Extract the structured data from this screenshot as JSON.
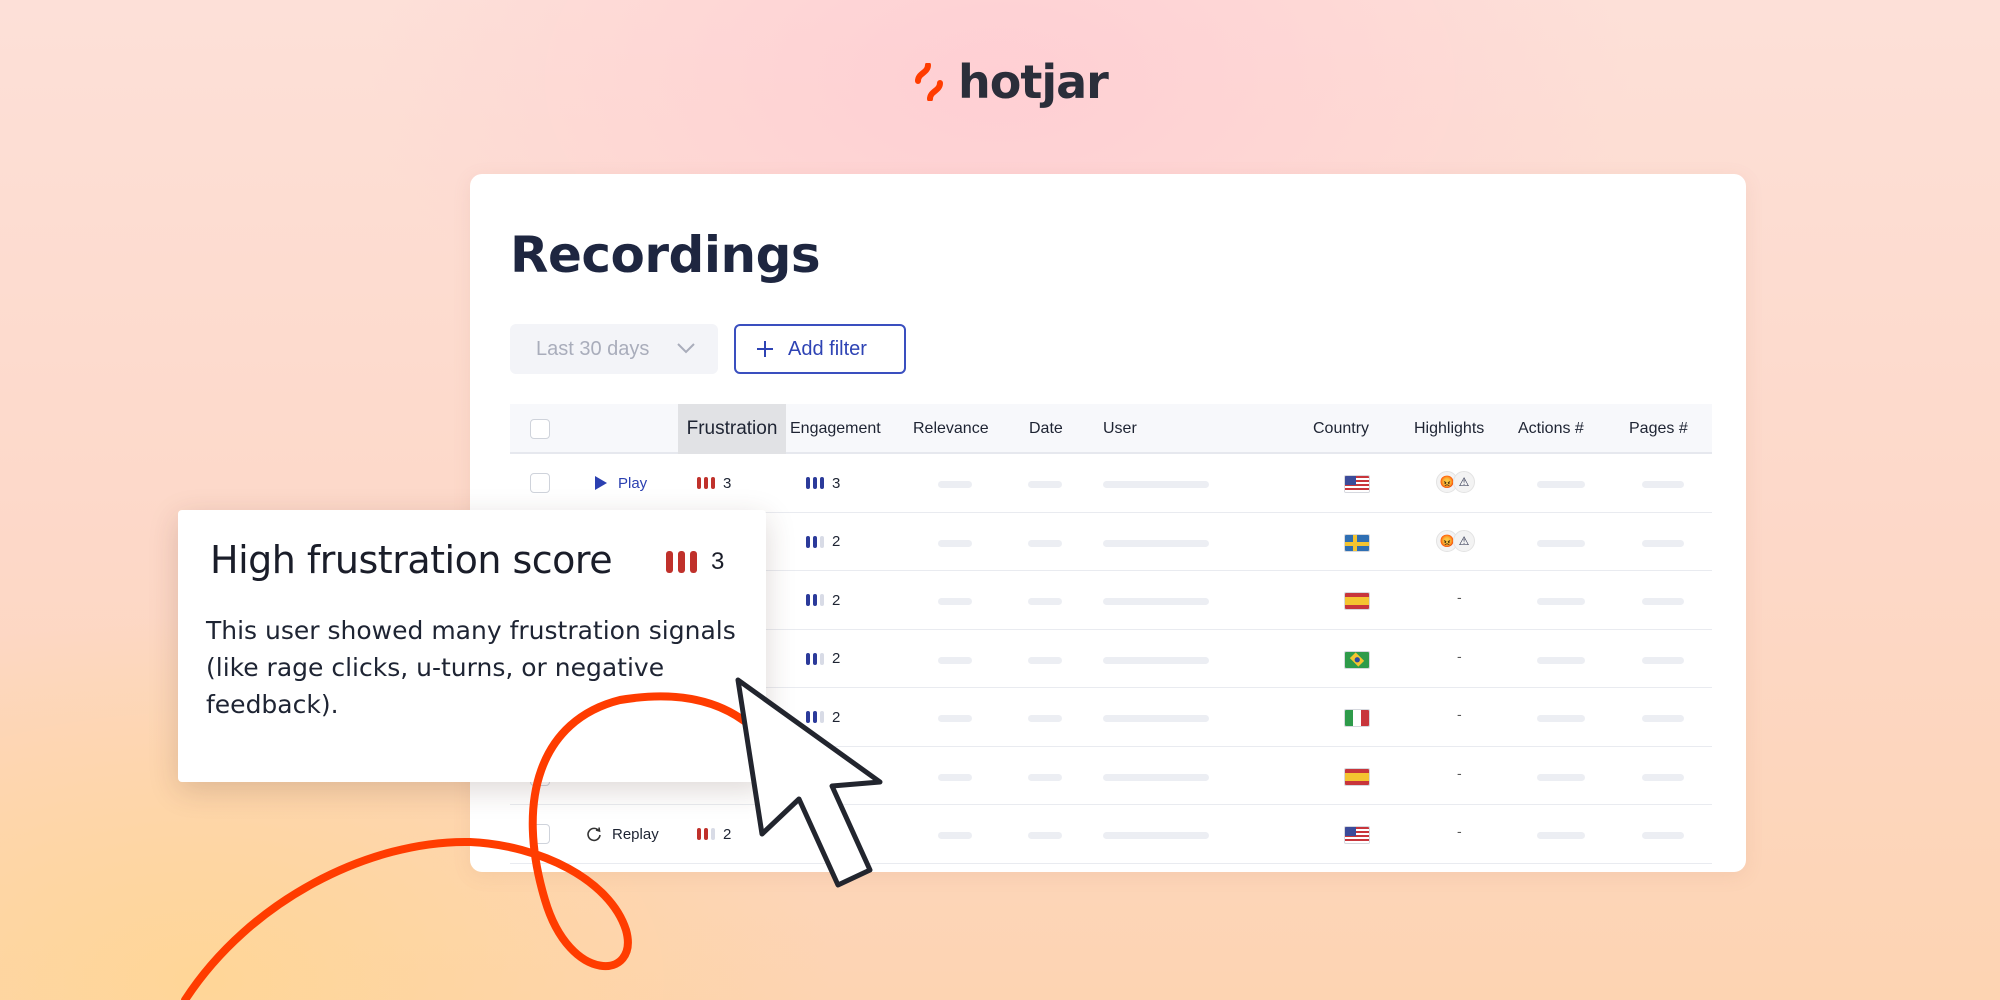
{
  "brand": {
    "name": "hotjar",
    "accent": "#ff3c00"
  },
  "page": {
    "title": "Recordings"
  },
  "filters": {
    "date_range": "Last 30 days",
    "add_filter": "Add filter"
  },
  "table": {
    "headers": [
      "Frustration",
      "Engagement",
      "Relevance",
      "Date",
      "User",
      "Country",
      "Highlights",
      "Actions #",
      "Pages #"
    ],
    "rows": [
      {
        "action": "Play",
        "action_icon": "play-icon",
        "frustration": "3",
        "engagement": "3",
        "country": "United States",
        "highlights": [
          "angry-face-icon",
          "warning-icon"
        ]
      },
      {
        "action": "",
        "frustration": "",
        "engagement": "2",
        "country": "Sweden",
        "highlights": [
          "angry-face-icon",
          "warning-icon"
        ]
      },
      {
        "action": "",
        "frustration": "",
        "engagement": "2",
        "country": "Spain",
        "highlights": "-"
      },
      {
        "action": "",
        "frustration": "",
        "engagement": "2",
        "country": "Brazil",
        "highlights": "-"
      },
      {
        "action": "",
        "frustration": "",
        "engagement": "2",
        "country": "Italy",
        "highlights": "-"
      },
      {
        "action": "",
        "frustration": "",
        "engagement": "",
        "country": "Spain",
        "highlights": "-"
      },
      {
        "action": "Replay",
        "action_icon": "replay-icon",
        "frustration": "2",
        "engagement": "",
        "country": "United States",
        "highlights": "-"
      }
    ]
  },
  "tooltip": {
    "title": "High frustration score",
    "score": "3",
    "body": "This user showed many frustration signals (like rage clicks, u-turns, or negative feedback)."
  },
  "colors": {
    "frustration": "#c0312b",
    "engagement": "#2b3a9a",
    "inactive": "#d8dbe6"
  }
}
